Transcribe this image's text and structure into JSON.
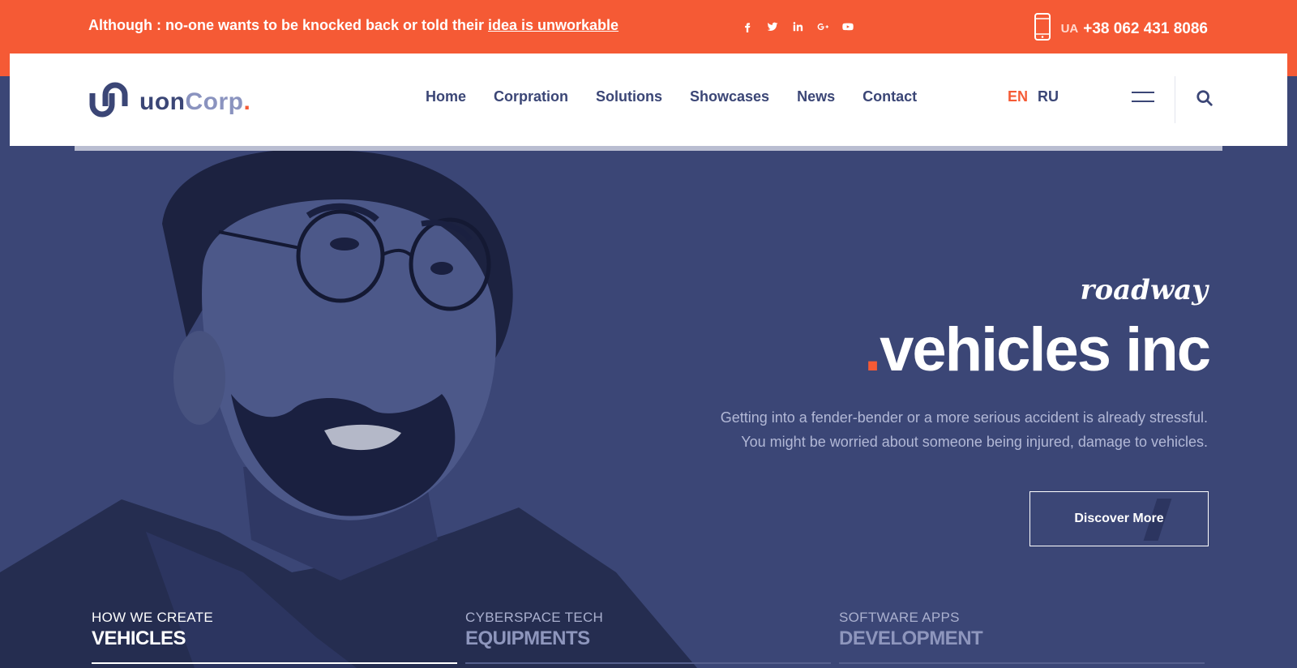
{
  "topbar": {
    "announce_prefix": "Although : no-one wants to be knocked back or told their ",
    "announce_link": "idea is unworkable",
    "socials": [
      "facebook-icon",
      "twitter-icon",
      "linkedin-icon",
      "google-plus-icon",
      "youtube-icon"
    ],
    "social_glyphs": [
      "f",
      "t",
      "in",
      "G+",
      "▶"
    ],
    "phone_prefix": "UA",
    "phone_number": "+38 062 431 8086"
  },
  "header": {
    "logo": {
      "part1": "uon",
      "part2": "Corp",
      "part3": "."
    },
    "nav": [
      "Home",
      "Corpration",
      "Solutions",
      "Showcases",
      "News",
      "Contact"
    ],
    "lang_active": "EN",
    "lang_other": "RU"
  },
  "hero": {
    "kicker": "roadway",
    "title_dot": ".",
    "title": "vehicles inc",
    "desc_line1": "Getting into a fender-bender or a more serious accident is already stressful.",
    "desc_line2": "You might be worried about someone being injured, damage to vehicles.",
    "button": "Discover More"
  },
  "tabs": [
    {
      "small": "HOW WE CREATE",
      "big": "VEHICLES",
      "active": true
    },
    {
      "small": "CYBERSPACE TECH",
      "big": "EQUIPMENTS",
      "active": false
    },
    {
      "small": "SOFTWARE APPS",
      "big": "DEVELOPMENT",
      "active": false
    }
  ],
  "colors": {
    "accent": "#f55a35",
    "primary": "#3b4676",
    "hero_bg": "#3b4676",
    "white": "#ffffff"
  }
}
